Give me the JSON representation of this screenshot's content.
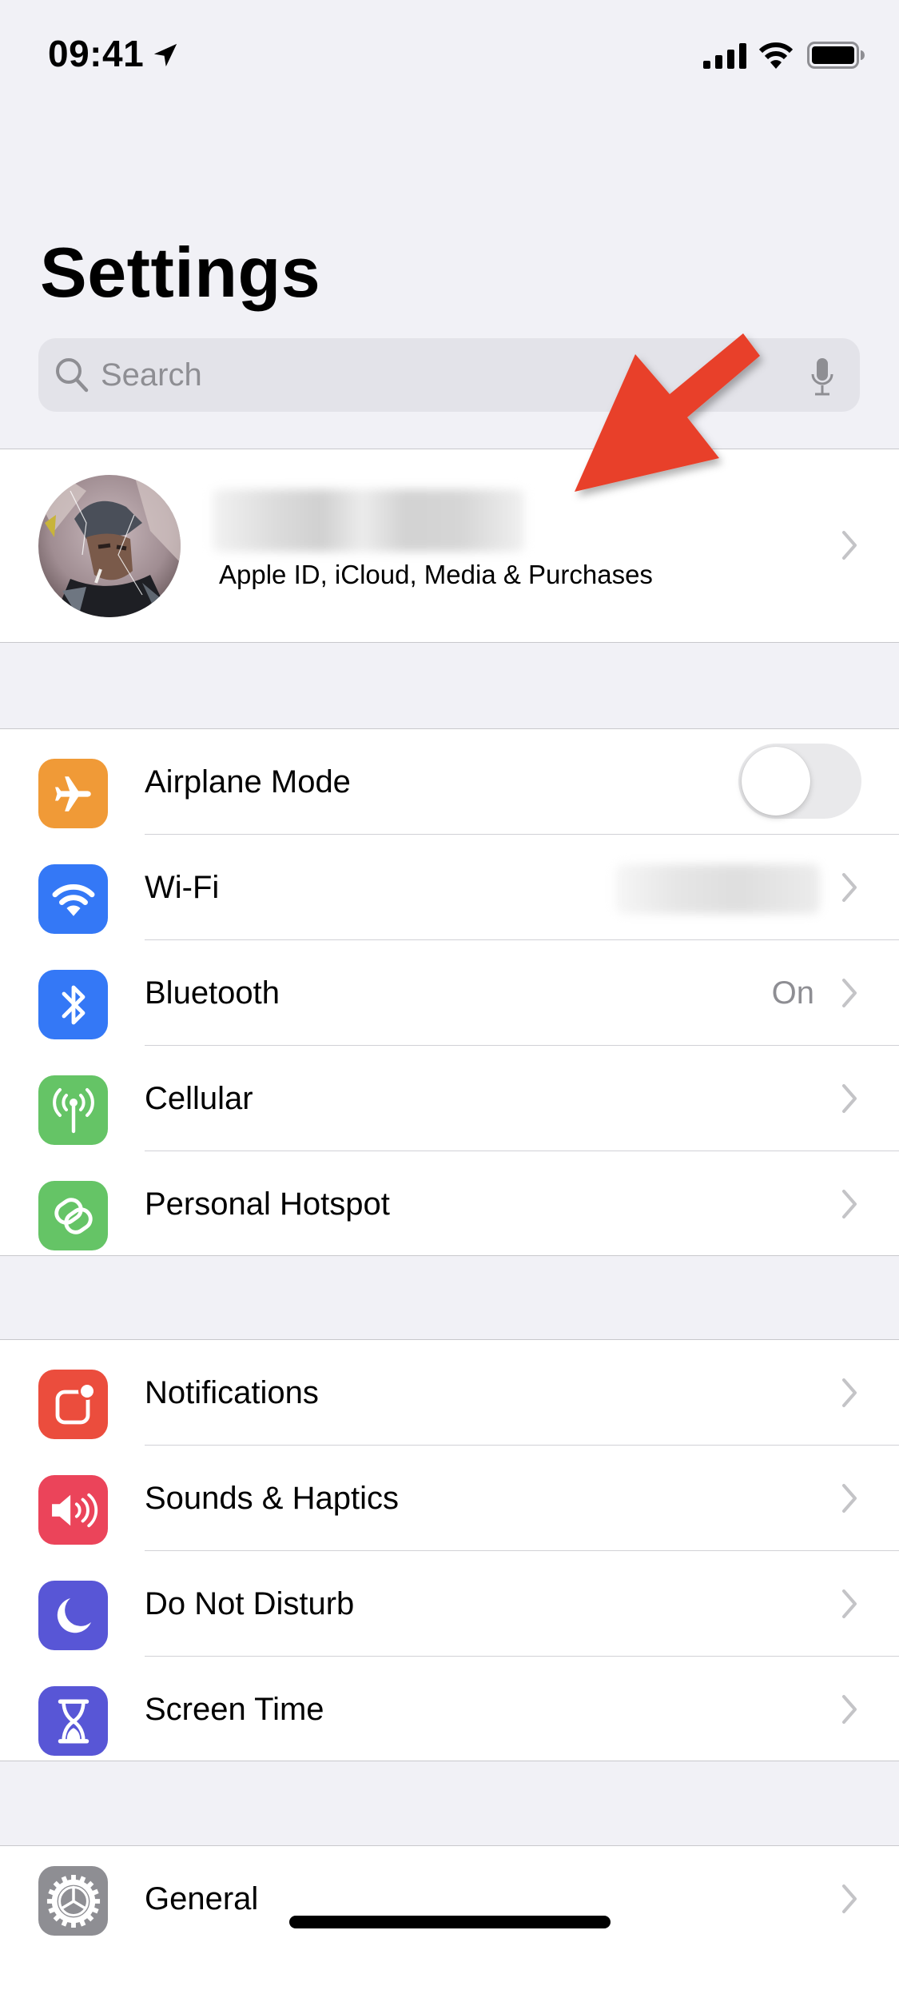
{
  "status_bar": {
    "time": "09:41",
    "icons": [
      "location-arrow-icon",
      "cellular-signal-icon",
      "wifi-icon",
      "battery-icon"
    ]
  },
  "header": {
    "title": "Settings"
  },
  "search": {
    "placeholder": "Search",
    "value": "",
    "icons": [
      "search-icon",
      "microphone-icon"
    ]
  },
  "profile": {
    "name": "[blurred]",
    "subtitle": "Apple ID, iCloud, Media & Purchases"
  },
  "annotation": {
    "type": "arrow",
    "color": "#e8412a",
    "target": "profile-name"
  },
  "sections": [
    {
      "items": [
        {
          "label": "Airplane Mode",
          "icon": "airplane-icon",
          "icon_color": "#f09a37",
          "control": "toggle",
          "toggle_on": false
        },
        {
          "label": "Wi-Fi",
          "icon": "wifi-icon",
          "icon_color": "#3478f6",
          "value": "[blurred]"
        },
        {
          "label": "Bluetooth",
          "icon": "bluetooth-icon",
          "icon_color": "#3478f6",
          "value": "On"
        },
        {
          "label": "Cellular",
          "icon": "cellular-antenna-icon",
          "icon_color": "#65c466"
        },
        {
          "label": "Personal Hotspot",
          "icon": "hotspot-link-icon",
          "icon_color": "#65c466"
        }
      ]
    },
    {
      "items": [
        {
          "label": "Notifications",
          "icon": "notifications-icon",
          "icon_color": "#eb4d3d"
        },
        {
          "label": "Sounds & Haptics",
          "icon": "speaker-icon",
          "icon_color": "#eb445a"
        },
        {
          "label": "Do Not Disturb",
          "icon": "moon-icon",
          "icon_color": "#5856d6"
        },
        {
          "label": "Screen Time",
          "icon": "hourglass-icon",
          "icon_color": "#5856d6"
        }
      ]
    },
    {
      "items": [
        {
          "label": "General",
          "icon": "gear-icon",
          "icon_color": "#8e8e93"
        }
      ]
    }
  ]
}
